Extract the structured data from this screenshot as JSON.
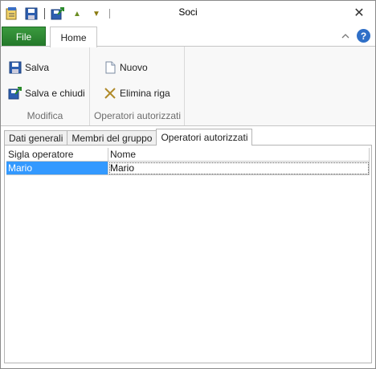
{
  "window": {
    "title": "Soci",
    "close_glyph": "✕"
  },
  "quick_access": {
    "items": [
      "app-menu-icon",
      "save-icon",
      "save-close-icon",
      "move-up-icon",
      "move-down-icon"
    ],
    "up_glyph": "▲",
    "down_glyph": "▼"
  },
  "ribbon_tabs": {
    "file": "File",
    "home": "Home"
  },
  "ribbon": {
    "groups": [
      {
        "label": "Modifica",
        "buttons": [
          "Salva",
          "Salva e chiudi"
        ]
      },
      {
        "label": "Operatori autorizzati",
        "buttons": [
          "Nuovo",
          "Elimina riga"
        ]
      }
    ]
  },
  "help_glyph": "?",
  "collapse_glyph": "^",
  "content_tabs": {
    "items": [
      "Dati generali",
      "Membri del gruppo",
      "Operatori autorizzati"
    ],
    "active": "Operatori autorizzati"
  },
  "grid": {
    "columns": [
      "Sigla operatore",
      "Nome"
    ],
    "rows": [
      {
        "sigla": "Mario",
        "nome": "Mario"
      }
    ]
  },
  "colors": {
    "file_tab": "#2e7d32",
    "selection": "#3399ff",
    "help": "#2f6fc7"
  }
}
